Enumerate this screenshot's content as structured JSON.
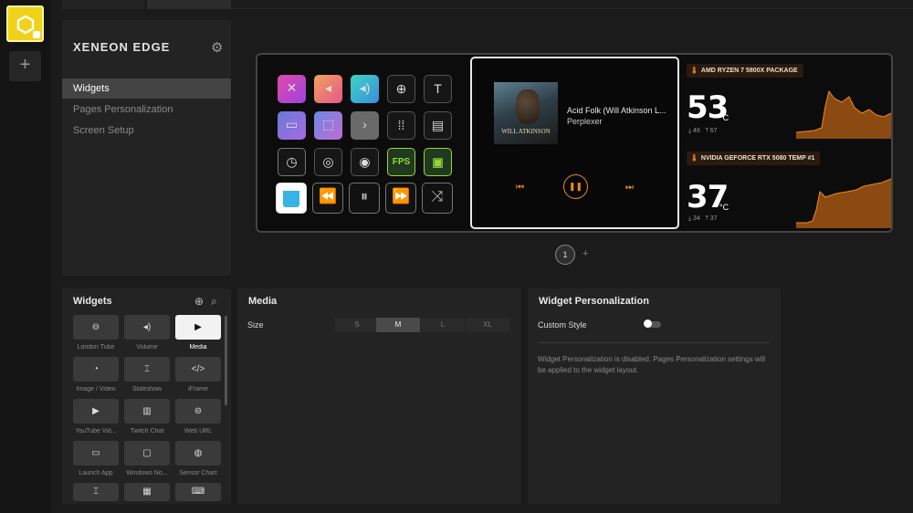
{
  "rail": {
    "add_label": "+"
  },
  "nav": {
    "title": "XENEON EDGE",
    "items": [
      "Widgets",
      "Pages Personalization",
      "Screen Setup"
    ]
  },
  "preview": {
    "media": {
      "song": "Acid Folk (Will Atkinson L...",
      "artist": "Perplexer",
      "album_text": "WILL ATKINSON"
    },
    "sensors": [
      {
        "label": "AMD RYZEN 7 5800X PACKAGE",
        "temp": "53",
        "unit": "°C",
        "min": "46",
        "max": "67"
      },
      {
        "label": "NVIDIA GEFORCE RTX 5080 TEMP #1",
        "temp": "37",
        "unit": "°C",
        "min": "34",
        "max": "37"
      }
    ],
    "fps_label": "FPS",
    "page_number": "1",
    "add_page": "+"
  },
  "widgets_panel": {
    "title": "Widgets",
    "tiles": [
      "London Tube",
      "Volume",
      "Media",
      "Image / Video",
      "Slideshow",
      "iFrame",
      "YouTube Vid...",
      "Twitch Chat",
      "Web URL",
      "Launch App",
      "Windows No...",
      "Sensor Chart",
      "",
      "",
      ""
    ]
  },
  "media_panel": {
    "title": "Media",
    "size_label": "Size",
    "sizes": [
      "S",
      "M",
      "L",
      "XL"
    ],
    "selected_size": "M"
  },
  "person_panel": {
    "title": "Widget Personalization",
    "custom_style_label": "Custom Style",
    "custom_style_on": false,
    "note": "Widget Personalization is disabled. Pages Personalization settings will be applied to the widget layout."
  },
  "colors": {
    "accent": "#f08a20",
    "device": "#f0d21a"
  }
}
